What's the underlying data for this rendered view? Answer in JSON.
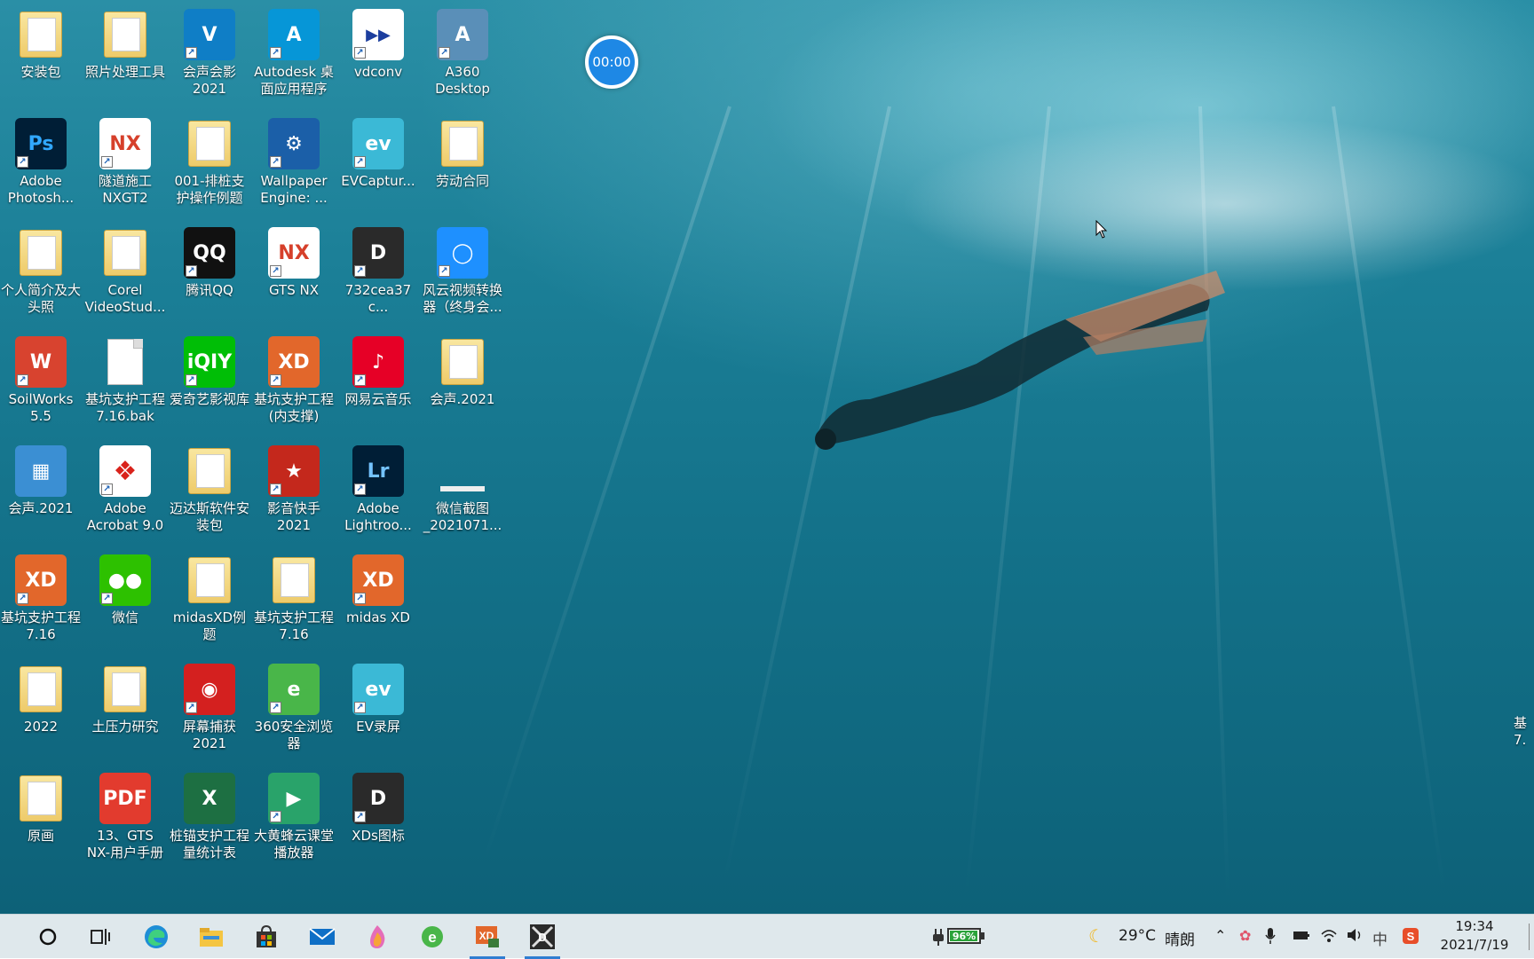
{
  "desktop": {
    "icons": [
      {
        "label": "安装包",
        "type": "folder"
      },
      {
        "label": "Adobe\nPhotosh...",
        "type": "ps"
      },
      {
        "label": "个人简介及大\n头照",
        "type": "folder"
      },
      {
        "label": "SoilWorks\n5.5",
        "type": "soilworks"
      },
      {
        "label": "会声.2021",
        "type": "archive"
      },
      {
        "label": "基坑支护工程\n7.16",
        "type": "xd"
      },
      {
        "label": "2022",
        "type": "folder"
      },
      {
        "label": "原画",
        "type": "folder"
      },
      {
        "label": "照片处理工具",
        "type": "folder"
      },
      {
        "label": "隧道施工\nNXGT2",
        "type": "nx"
      },
      {
        "label": "Corel\nVideoStud...",
        "type": "folder"
      },
      {
        "label": "基坑支护工程\n7.16.bak",
        "type": "doc"
      },
      {
        "label": "Adobe\nAcrobat 9.0",
        "type": "acrobat"
      },
      {
        "label": "微信",
        "type": "wechat"
      },
      {
        "label": "土压力研究",
        "type": "folder"
      },
      {
        "label": "13、GTS\nNX-用户手册",
        "type": "pdf"
      },
      {
        "label": "会声会影\n2021",
        "type": "corel"
      },
      {
        "label": "001-排桩支\n护操作例题",
        "type": "folder"
      },
      {
        "label": "腾讯QQ",
        "type": "qq"
      },
      {
        "label": "爱奇艺影视库",
        "type": "iqiyi"
      },
      {
        "label": "迈达斯软件安\n装包",
        "type": "folder"
      },
      {
        "label": "midasXD例\n题",
        "type": "folder"
      },
      {
        "label": "屏幕捕获\n2021",
        "type": "capture"
      },
      {
        "label": "桩锚支护工程\n量统计表",
        "type": "excel"
      },
      {
        "label": "Autodesk 桌\n面应用程序",
        "type": "autodesk"
      },
      {
        "label": "Wallpaper\nEngine: ...",
        "type": "wallpaper"
      },
      {
        "label": "GTS NX",
        "type": "nx"
      },
      {
        "label": "基坑支护工程\n(内支撑)",
        "type": "xd"
      },
      {
        "label": "影音快手\n2021",
        "type": "yingyin"
      },
      {
        "label": "基坑支护工程\n7.16",
        "type": "folder"
      },
      {
        "label": "360安全浏览\n器",
        "type": "ie360"
      },
      {
        "label": "大黄蜂云课堂\n播放器",
        "type": "hornet"
      },
      {
        "label": "vdconv",
        "type": "vdconv"
      },
      {
        "label": "EVCaptur...",
        "type": "ev"
      },
      {
        "label": "732cea37c...",
        "type": "dxd"
      },
      {
        "label": "网易云音乐",
        "type": "netease"
      },
      {
        "label": "Adobe\nLightroo...",
        "type": "lr"
      },
      {
        "label": "midas XD",
        "type": "xd"
      },
      {
        "label": "EV录屏",
        "type": "ev"
      },
      {
        "label": "XDs图标",
        "type": "dxd"
      },
      {
        "label": "A360\nDesktop",
        "type": "a360"
      },
      {
        "label": "劳动合同",
        "type": "folder"
      },
      {
        "label": "风云视频转换\n器（终身会...",
        "type": "fengyun"
      },
      {
        "label": "会声.2021",
        "type": "folder"
      },
      {
        "label": "微信截图\n_2021071...",
        "type": "screenshot"
      }
    ],
    "timer": "00:00",
    "edge_label": "基\n7."
  },
  "taskbar": {
    "battery": "96%",
    "weather_temp": "29°C",
    "weather_desc": "晴朗",
    "ime": "中",
    "time": "19:34",
    "date": "2021/7/19"
  },
  "colors": {
    "taskbar_bg": "#dfe8ec",
    "water_top": "#2a8fa6",
    "water_bottom": "#0d6178",
    "accent": "#2f7dd1"
  }
}
